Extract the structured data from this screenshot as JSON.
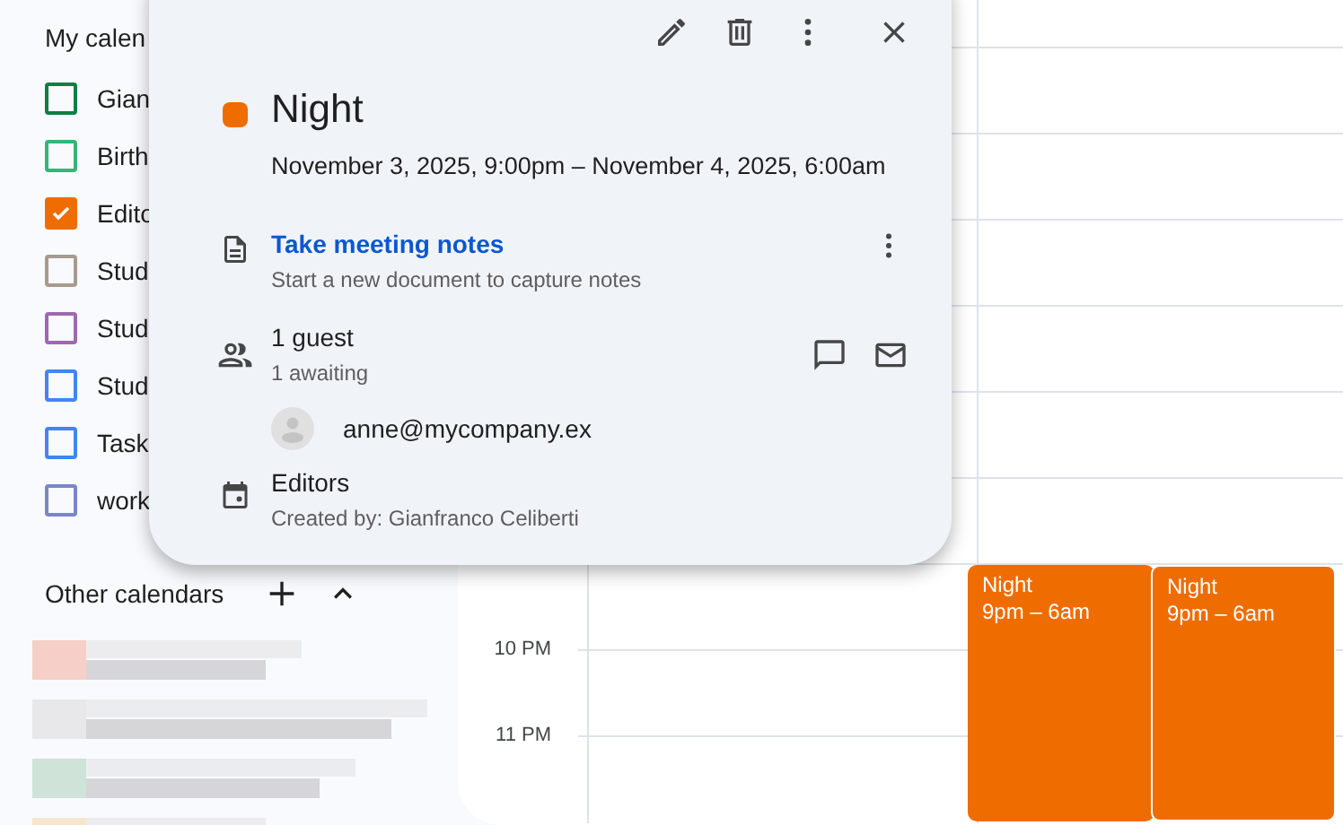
{
  "sidebar": {
    "my_calendars": {
      "title": "My calen",
      "items": [
        {
          "label": "Gian",
          "color": "#0b8043",
          "checked": false
        },
        {
          "label": "Birth",
          "color": "#33b679",
          "checked": false
        },
        {
          "label": "Edito",
          "color": "#ef6c00",
          "checked": true
        },
        {
          "label": "Stud",
          "color": "#a79b8e",
          "checked": false
        },
        {
          "label": "Stud",
          "color": "#9e69af",
          "checked": false
        },
        {
          "label": "Stud",
          "color": "#4285f4",
          "checked": false
        },
        {
          "label": "Task",
          "color": "#4285f4",
          "checked": false
        },
        {
          "label": "work",
          "color": "#7986cb",
          "checked": false
        }
      ]
    },
    "other_calendars": {
      "title": "Other calendars",
      "entries": [
        {
          "color": "#f6cfc8"
        },
        {
          "color": "#e8e8ea"
        },
        {
          "color": "#cfe3d8"
        },
        {
          "color": "#f7e6cf"
        }
      ]
    }
  },
  "time_labels": [
    "10 PM",
    "11 PM"
  ],
  "events": [
    {
      "title": "Night",
      "time": "9pm – 6am",
      "color": "#ef6c00"
    },
    {
      "title": "Night",
      "time": "9pm – 6am",
      "color": "#ef6c00"
    }
  ],
  "popup": {
    "color": "#ef6c00",
    "title": "Night",
    "when": "November 3, 2025, 9:00pm – November 4, 2025, 6:00am",
    "notes": {
      "link": "Take meeting notes",
      "hint": "Start a new document to capture notes"
    },
    "guests": {
      "count": "1 guest",
      "status": "1 awaiting",
      "list": [
        {
          "email": "anne@mycompany.ex"
        }
      ]
    },
    "calendar": {
      "name": "Editors",
      "creator": "Created by: Gianfranco Celiberti"
    }
  }
}
